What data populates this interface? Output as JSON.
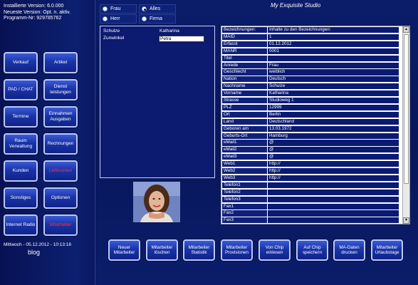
{
  "app": {
    "title": "My Exquisite Studio",
    "version_lines": [
      "Installierte Version: 6.0.000",
      "Neueste Version: Opt. n. aktiv.",
      "Programm-Nr: 929785762"
    ]
  },
  "sidebar": {
    "buttons": [
      [
        "Verkauf",
        "Artikel"
      ],
      [
        "PAD / CHAT",
        "Dienst leistungen"
      ],
      [
        "Termine",
        "Einnahmen Ausgaben"
      ],
      [
        "Raum Verwaltung",
        "Rechnungen"
      ],
      [
        "Kunden",
        "Lieferanten"
      ],
      [
        "Sonstiges",
        "Optionen"
      ],
      [
        "Internet Radio",
        "Mitarbeiter"
      ]
    ],
    "datetime": "Mittwoch - 05.12.2012 - 10:13:16",
    "blog_label": "blog"
  },
  "filters": {
    "options": [
      {
        "label": "Frau",
        "checked": false
      },
      {
        "label": "Alles",
        "checked": true
      },
      {
        "label": "Herr",
        "checked": false
      },
      {
        "label": "Firma",
        "checked": false
      }
    ]
  },
  "name_list": {
    "rows": [
      {
        "label": "Schulze",
        "value": "Katharina"
      },
      {
        "label": "Zunwinkel",
        "value": "Petra"
      }
    ]
  },
  "details": {
    "header": {
      "key": "Bezeichnungen:",
      "value": "Inhalte zu den Bezeichnungen:"
    },
    "rows": [
      {
        "key": "MAID",
        "value": "1"
      },
      {
        "key": "Erfasst",
        "value": "01.12.2012"
      },
      {
        "key": "MANR",
        "value": "0001"
      },
      {
        "key": "Titel",
        "value": ""
      },
      {
        "key": "Anrede",
        "value": "Frau"
      },
      {
        "key": "Geschlecht",
        "value": "weiblich"
      },
      {
        "key": "Nation",
        "value": "Deutsch"
      },
      {
        "key": "Nachname",
        "value": "Schulze"
      },
      {
        "key": "Vorname",
        "value": "Katharina"
      },
      {
        "key": "Strasse",
        "value": "Studioweg 1"
      },
      {
        "key": "PLZ",
        "value": "12999"
      },
      {
        "key": "Ort",
        "value": "Berlin"
      },
      {
        "key": "Land",
        "value": "Deutschland"
      },
      {
        "key": "Geboren am",
        "value": "13.03.1972"
      },
      {
        "key": "Geburts-Ort",
        "value": "Hamburg"
      },
      {
        "key": "eMail1",
        "value": "@"
      },
      {
        "key": "eMail2",
        "value": "@"
      },
      {
        "key": "eMail3",
        "value": "@"
      },
      {
        "key": "Web1",
        "value": "http://"
      },
      {
        "key": "Web2",
        "value": "http://"
      },
      {
        "key": "Web3",
        "value": "http://"
      },
      {
        "key": "Telefon1",
        "value": ""
      },
      {
        "key": "Telefon2",
        "value": ""
      },
      {
        "key": "Telefon3",
        "value": ""
      },
      {
        "key": "Fax1",
        "value": ""
      },
      {
        "key": "Fax2",
        "value": ""
      },
      {
        "key": "Fax3",
        "value": ""
      }
    ]
  },
  "toolbar": {
    "buttons": [
      "Neuer Mitarbeiter",
      "Mitarbeiter löschen",
      "Mitarbeiter Statistik",
      "Mitarbeiter Provisionen",
      "Von Chip einlesen",
      "Auf Chip speichern",
      "MA-Daten drucken",
      "Mitarbeiter Urlaubstage"
    ]
  },
  "photo": {
    "icon": "employee-photo"
  },
  "colors": {
    "background": "#0a1a66",
    "button": "#1a34a8",
    "red_text": "#ff3030"
  }
}
